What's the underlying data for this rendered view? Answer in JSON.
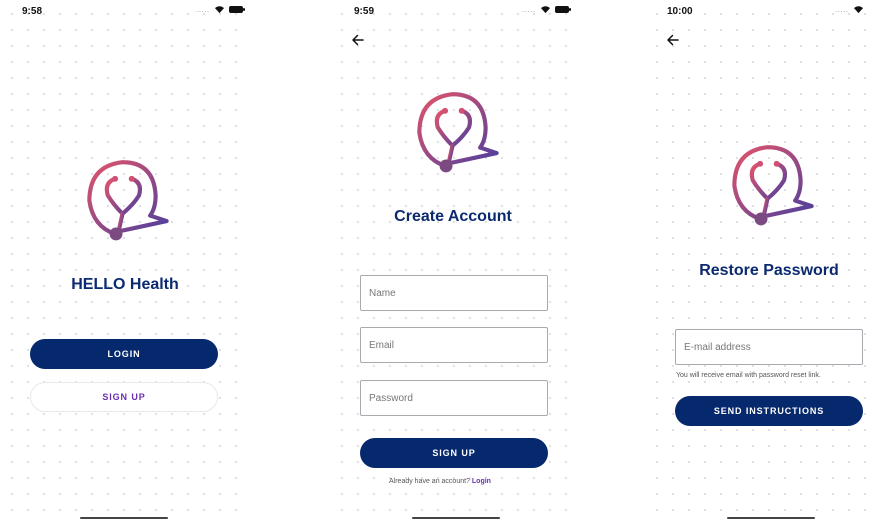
{
  "colors": {
    "navy": "#06286c",
    "title_navy": "#0b2a6f",
    "purple_link": "#6a2fb0",
    "logo_gradient": [
      "#e2546a",
      "#4b3f9e"
    ]
  },
  "screens": [
    {
      "status": {
        "time": "9:58",
        "signal": "....."
      },
      "title": "HELLO Health",
      "login_label": "LOGIN",
      "signup_label": "SIGN UP"
    },
    {
      "status": {
        "time": "9:59",
        "signal": "....."
      },
      "title": "Create Account",
      "fields": {
        "name_placeholder": "Name",
        "email_placeholder": "Email",
        "password_placeholder": "Password"
      },
      "signup_label": "SIGN UP",
      "footer_text": "Already have an account?",
      "footer_link": "Login"
    },
    {
      "status": {
        "time": "10:00",
        "signal": "....."
      },
      "title": "Restore Password",
      "email_placeholder": "E-mail address",
      "hint": "You will receive email with password reset link.",
      "send_label": "SEND INSTRUCTIONS"
    }
  ]
}
